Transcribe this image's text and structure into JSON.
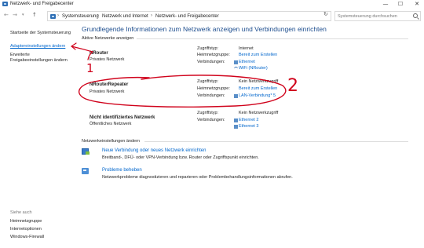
{
  "window": {
    "title": "Netzwerk- und Freigabecenter",
    "minimize_glyph": "—",
    "maximize_glyph": "☐",
    "close_glyph": "✕"
  },
  "nav": {
    "back_glyph": "←",
    "forward_glyph": "→",
    "recent_glyph": "▾",
    "up_glyph": "↑"
  },
  "address": {
    "breadcrumbs": [
      "Systemsteuerung",
      "Netzwerk und Internet",
      "Netzwerk- und Freigabecenter"
    ],
    "separator": "›",
    "root_glyph": "›",
    "dropdown_glyph": "▾",
    "refresh_glyph": "↻"
  },
  "search": {
    "placeholder": "Systemsteuerung durchsuchen"
  },
  "sidebar": {
    "home": "Startseite der Systemsteuerung",
    "adapter": "Adaptereinstellungen ändern",
    "sharing_line1": "Erweiterte",
    "sharing_line2": "Freigabeeinstellungen ändern",
    "see_also": "Siehe auch",
    "links": [
      "Heimnetzgruppe",
      "Internetoptionen",
      "Windows-Firewall"
    ]
  },
  "main": {
    "heading": "Grundlegende Informationen zum Netzwerk anzeigen und Verbindungen einrichten",
    "active_label": "Aktive Netzwerke anzeigen",
    "networks": [
      {
        "name": "NRouter",
        "type": "Privates Netzwerk",
        "access_label": "Zugriffstyp:",
        "access_value": "Internet",
        "homegroup_label": "Heimnetzgruppe:",
        "homegroup_value": "Bereit zum Erstellen",
        "connections_label": "Verbindungen:",
        "connections": [
          "Ethernet",
          "WiFi (NRouter)"
        ]
      },
      {
        "name": "NRouterRepeater",
        "type": "Privates Netzwerk",
        "access_label": "Zugriffstyp:",
        "access_value": "Kein Netzwerkzugriff",
        "homegroup_label": "Heimnetzgruppe:",
        "homegroup_value": "Bereit zum Erstellen",
        "connections_label": "Verbindungen:",
        "connections": [
          "LAN-Verbindung* 5"
        ]
      },
      {
        "name": "Nicht identifiziertes Netzwerk",
        "type": "Öffentliches Netzwerk",
        "access_label": "Zugriffstyp:",
        "access_value": "Kein Netzwerkzugriff",
        "connections_label": "Verbindungen:",
        "connections": [
          "Ethernet 2",
          "Ethernet 3"
        ]
      }
    ],
    "change_label": "Netzwerkeinstellungen ändern",
    "tasks": [
      {
        "title": "Neue Verbindung oder neues Netzwerk einrichten",
        "description": "Breitband-, DFÜ- oder VPN-Verbindung bzw. Router oder Zugriffspunkt einrichten."
      },
      {
        "title": "Probleme beheben",
        "description": "Netzwerkprobleme diagnostizieren und reparieren oder Problembehandlungsinformationen abrufen."
      }
    ]
  },
  "annotations": {
    "mark1": "1",
    "mark2": "2",
    "color": "#d0021b"
  }
}
